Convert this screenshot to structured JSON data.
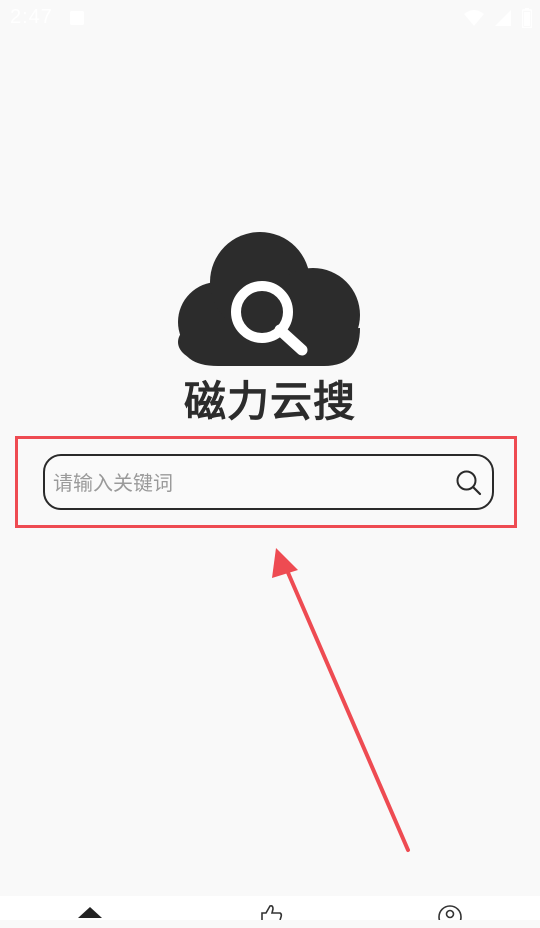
{
  "status_bar": {
    "time": "2:47",
    "icons": [
      "notification-icon",
      "wifi-icon",
      "signal-icon",
      "battery-icon"
    ]
  },
  "app": {
    "title": "磁力云搜",
    "logo_icon": "cloud-search-icon"
  },
  "search": {
    "placeholder": "请输入关键词",
    "value": "",
    "button_icon": "search-icon"
  },
  "annotations": {
    "highlight_color": "#ee4b52",
    "arrow_color": "#ee4b52"
  },
  "bottom_nav": {
    "items": [
      {
        "icon": "home-icon"
      },
      {
        "icon": "thumbs-up-icon"
      },
      {
        "icon": "profile-icon"
      }
    ]
  },
  "colors": {
    "background": "#f9f9f9",
    "dark": "#2c2c2c"
  }
}
